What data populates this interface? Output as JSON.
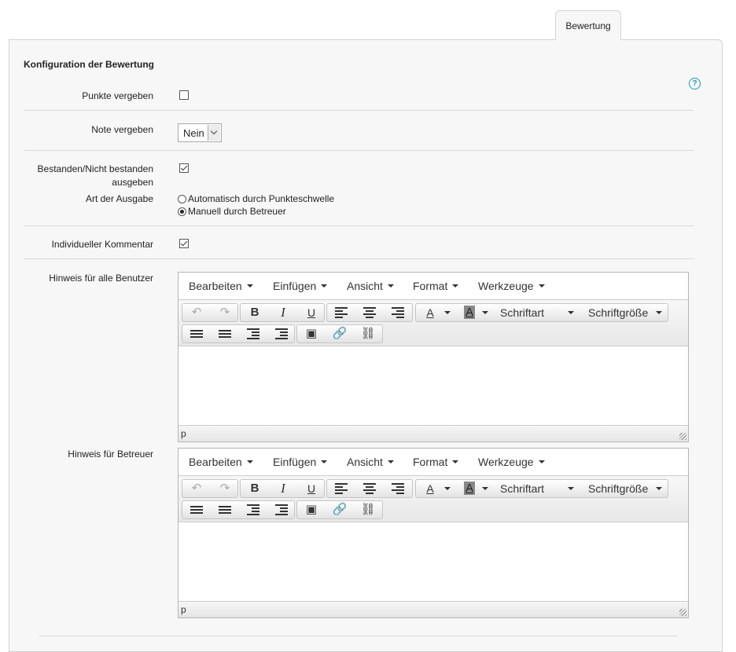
{
  "tab": {
    "label": "Bewertung"
  },
  "section": {
    "title": "Konfiguration der Bewertung"
  },
  "help": {
    "glyph": "?"
  },
  "fields": {
    "points": {
      "label": "Punkte vergeben",
      "checked": false
    },
    "grade": {
      "label": "Note vergeben",
      "value": "Nein"
    },
    "passed": {
      "label_line1": "Bestanden/Nicht bestanden",
      "label_line2": "ausgeben",
      "checked": true
    },
    "output": {
      "label": "Art der Ausgabe",
      "option_auto": "Automatisch durch Punkteschwelle",
      "option_manual": "Manuell durch Betreuer",
      "selected": "manual"
    },
    "comment": {
      "label": "Individueller Kommentar",
      "checked": true
    },
    "hint_all": {
      "label": "Hinweis für alle Benutzer"
    },
    "hint_coach": {
      "label": "Hinweis für Betreuer"
    }
  },
  "editor": {
    "menus": [
      "Bearbeiten",
      "Einfügen",
      "Ansicht",
      "Format",
      "Werkzeuge"
    ],
    "font_family": "Schriftart",
    "font_size": "Schriftgröße",
    "bold": "B",
    "italic": "I",
    "underline": "U",
    "text_color": "A",
    "bg_color": "A",
    "status_path": "p",
    "icons": [
      "undo-icon",
      "redo-icon",
      "bold-icon",
      "italic-icon",
      "underline-icon",
      "align-left-icon",
      "align-center-icon",
      "align-right-icon",
      "text-color-icon",
      "background-color-icon",
      "bullet-list-icon",
      "numbered-list-icon",
      "indent-icon",
      "outdent-icon",
      "image-icon",
      "link-icon",
      "unlink-icon"
    ]
  }
}
